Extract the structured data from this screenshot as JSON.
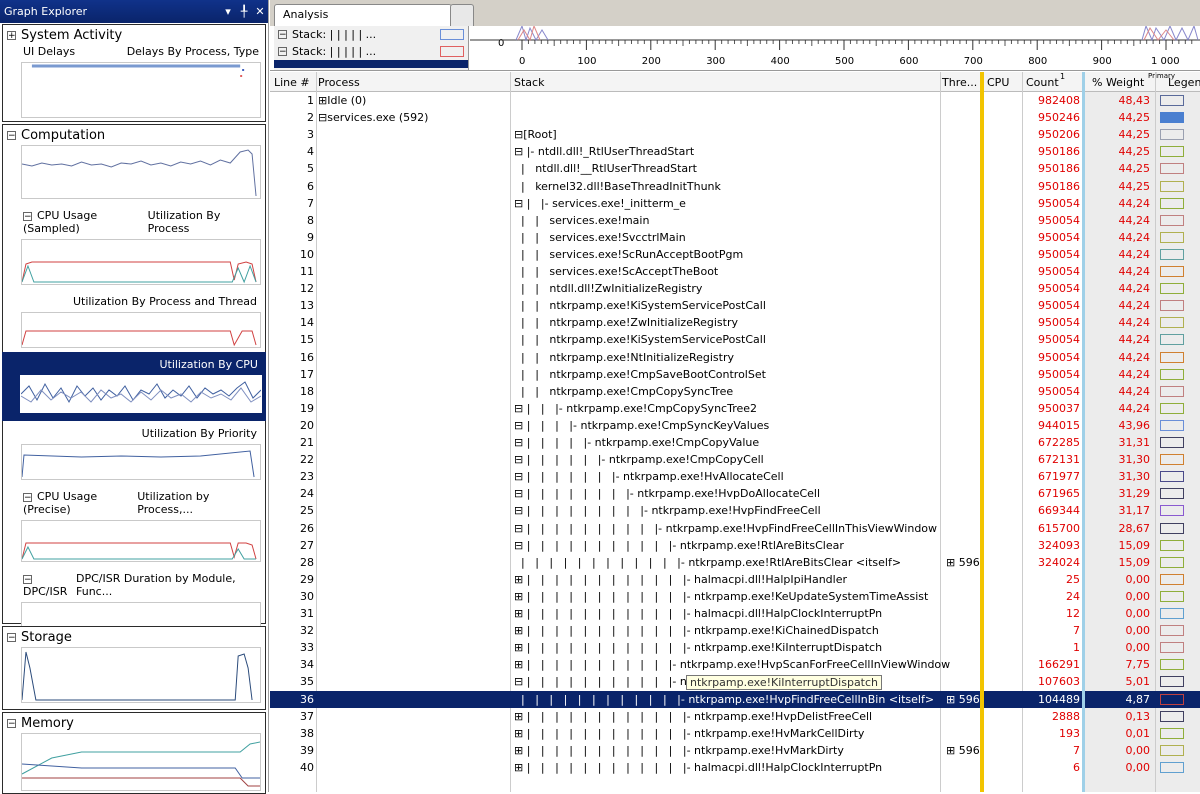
{
  "explorer": {
    "title": "Graph Explorer",
    "controls": [
      "▾",
      "╀",
      "✕"
    ],
    "groups": [
      {
        "name": "System Activity",
        "sub_left": "UI Delays",
        "sub_right": "Delays By Process, Type"
      },
      {
        "name": "Computation"
      },
      {
        "name": "CPU Usage (Sampled)",
        "sub_right": "Utilization By Process"
      },
      {
        "name": "Utilization By Process and Thread"
      },
      {
        "name": "Utilization By CPU"
      },
      {
        "name": "Utilization By Priority"
      },
      {
        "name": "CPU Usage (Precise)",
        "sub_right": "Utilization by Process,..."
      },
      {
        "name": "DPC/ISR",
        "sub_right": "DPC/ISR Duration by Module, Func..."
      },
      {
        "name": "Storage"
      },
      {
        "name": "Memory"
      }
    ]
  },
  "analysis": {
    "tab": "Analysis",
    "legend_rows": [
      {
        "label": "Stack:",
        "dots": "| | | | | ...",
        "color": "#6a8fd8"
      },
      {
        "label": "Stack:",
        "dots": "| | | | | ...",
        "color": "#e06060"
      },
      {
        "label": "Stack:",
        "dots": "| | | | | ...",
        "color": "#cc4444"
      }
    ],
    "axis_zero": "0",
    "axis_ticks": [
      "0",
      "100",
      "200",
      "300",
      "400",
      "500",
      "600",
      "700",
      "800",
      "900",
      "1 000"
    ]
  },
  "table": {
    "headers": {
      "line": "Line #",
      "process": "Process",
      "stack": "Stack",
      "thread": "Thre...",
      "cpu": "CPU",
      "count": "Count",
      "count_sup": "1",
      "weight": "% Weight",
      "weight_sup": "Primary",
      "legend": "Legend"
    },
    "tooltip": "ntkrpamp.exe!KiInterruptDispatch",
    "rows": [
      {
        "n": "1",
        "proc": "⊞Idle (0)",
        "stk": "",
        "thr": "",
        "cnt": "982408",
        "wt": "48,43",
        "lg": "#5a6a9a"
      },
      {
        "n": "2",
        "proc": "⊟services.exe (592)",
        "stk": "",
        "thr": "",
        "cnt": "950246",
        "wt": "44,25",
        "lg": "#4a7fd0",
        "lgfill": true
      },
      {
        "n": "3",
        "proc": "",
        "stk": "⊟[Root]",
        "thr": "",
        "cnt": "950206",
        "wt": "44,25",
        "lg": "#9aa0b0"
      },
      {
        "n": "4",
        "proc": "",
        "stk": "⊟ |- ntdll.dll!_RtlUserThreadStart",
        "thr": "",
        "cnt": "950186",
        "wt": "44,25",
        "lg": "#8fae3a"
      },
      {
        "n": "5",
        "proc": "",
        "stk": "  |   ntdll.dll!__RtlUserThreadStart",
        "thr": "",
        "cnt": "950186",
        "wt": "44,25",
        "lg": "#c08080"
      },
      {
        "n": "6",
        "proc": "",
        "stk": "  |   kernel32.dll!BaseThreadInitThunk",
        "thr": "",
        "cnt": "950186",
        "wt": "44,25",
        "lg": "#b0b050"
      },
      {
        "n": "7",
        "proc": "",
        "stk": "⊟ |   |- services.exe!_initterm_e",
        "thr": "",
        "cnt": "950054",
        "wt": "44,24",
        "lg": "#8fae3a"
      },
      {
        "n": "8",
        "proc": "",
        "stk": "  |   |   services.exe!main",
        "thr": "",
        "cnt": "950054",
        "wt": "44,24",
        "lg": "#c08080"
      },
      {
        "n": "9",
        "proc": "",
        "stk": "  |   |   services.exe!SvcctrlMain",
        "thr": "",
        "cnt": "950054",
        "wt": "44,24",
        "lg": "#b0b050"
      },
      {
        "n": "10",
        "proc": "",
        "stk": "  |   |   services.exe!ScRunAcceptBootPgm",
        "thr": "",
        "cnt": "950054",
        "wt": "44,24",
        "lg": "#60a0a0"
      },
      {
        "n": "11",
        "proc": "",
        "stk": "  |   |   services.exe!ScAcceptTheBoot",
        "thr": "",
        "cnt": "950054",
        "wt": "44,24",
        "lg": "#d08030"
      },
      {
        "n": "12",
        "proc": "",
        "stk": "  |   |   ntdll.dll!ZwInitializeRegistry",
        "thr": "",
        "cnt": "950054",
        "wt": "44,24",
        "lg": "#8fae3a"
      },
      {
        "n": "13",
        "proc": "",
        "stk": "  |   |   ntkrpamp.exe!KiSystemServicePostCall",
        "thr": "",
        "cnt": "950054",
        "wt": "44,24",
        "lg": "#c08080"
      },
      {
        "n": "14",
        "proc": "",
        "stk": "  |   |   ntkrpamp.exe!ZwInitializeRegistry",
        "thr": "",
        "cnt": "950054",
        "wt": "44,24",
        "lg": "#b0b050"
      },
      {
        "n": "15",
        "proc": "",
        "stk": "  |   |   ntkrpamp.exe!KiSystemServicePostCall",
        "thr": "",
        "cnt": "950054",
        "wt": "44,24",
        "lg": "#60a0a0"
      },
      {
        "n": "16",
        "proc": "",
        "stk": "  |   |   ntkrpamp.exe!NtInitializeRegistry",
        "thr": "",
        "cnt": "950054",
        "wt": "44,24",
        "lg": "#d08030"
      },
      {
        "n": "17",
        "proc": "",
        "stk": "  |   |   ntkrpamp.exe!CmpSaveBootControlSet",
        "thr": "",
        "cnt": "950054",
        "wt": "44,24",
        "lg": "#8fae3a"
      },
      {
        "n": "18",
        "proc": "",
        "stk": "  |   |   ntkrpamp.exe!CmpCopySyncTree",
        "thr": "",
        "cnt": "950054",
        "wt": "44,24",
        "lg": "#c08080"
      },
      {
        "n": "19",
        "proc": "",
        "stk": "⊟ |   |   |- ntkrpamp.exe!CmpCopySyncTree2",
        "thr": "",
        "cnt": "950037",
        "wt": "44,24",
        "lg": "#8fae3a"
      },
      {
        "n": "20",
        "proc": "",
        "stk": "⊟ |   |   |   |- ntkrpamp.exe!CmpSyncKeyValues",
        "thr": "",
        "cnt": "944015",
        "wt": "43,96",
        "lg": "#6a8fd8"
      },
      {
        "n": "21",
        "proc": "",
        "stk": "⊟ |   |   |   |   |- ntkrpamp.exe!CmpCopyValue",
        "thr": "",
        "cnt": "672285",
        "wt": "31,31",
        "lg": "#404060"
      },
      {
        "n": "22",
        "proc": "",
        "stk": "⊟ |   |   |   |   |   |- ntkrpamp.exe!CmpCopyCell",
        "thr": "",
        "cnt": "672131",
        "wt": "31,30",
        "lg": "#d08030"
      },
      {
        "n": "23",
        "proc": "",
        "stk": "⊟ |   |   |   |   |   |   |- ntkrpamp.exe!HvAllocateCell",
        "thr": "",
        "cnt": "671977",
        "wt": "31,30",
        "lg": "#4a4a8a"
      },
      {
        "n": "24",
        "proc": "",
        "stk": "⊟ |   |   |   |   |   |   |   |- ntkrpamp.exe!HvpDoAllocateCell",
        "thr": "",
        "cnt": "671965",
        "wt": "31,29",
        "lg": "#404060"
      },
      {
        "n": "25",
        "proc": "",
        "stk": "⊟ |   |   |   |   |   |   |   |   |- ntkrpamp.exe!HvpFindFreeCell",
        "thr": "",
        "cnt": "669344",
        "wt": "31,17",
        "lg": "#8a5ad0"
      },
      {
        "n": "26",
        "proc": "",
        "stk": "⊟ |   |   |   |   |   |   |   |   |   |- ntkrpamp.exe!HvpFindFreeCellInThisViewWindow",
        "thr": "",
        "cnt": "615700",
        "wt": "28,67",
        "lg": "#404060"
      },
      {
        "n": "27",
        "proc": "",
        "stk": "⊟ |   |   |   |   |   |   |   |   |   |   |- ntkrpamp.exe!RtlAreBitsClear",
        "thr": "",
        "cnt": "324093",
        "wt": "15,09",
        "lg": "#8fae3a"
      },
      {
        "n": "28",
        "proc": "",
        "stk": "  |   |   |   |   |   |   |   |   |   |   |   |- ntkrpamp.exe!RtlAreBitsClear <itself>",
        "thr": "⊞ 596",
        "cnt": "324024",
        "wt": "15,09",
        "lg": "#8fae3a"
      },
      {
        "n": "29",
        "proc": "",
        "stk": "⊞ |   |   |   |   |   |   |   |   |   |   |   |- halmacpi.dll!HalpIpiHandler",
        "thr": "",
        "cnt": "25",
        "wt": "0,00",
        "lg": "#d08030"
      },
      {
        "n": "30",
        "proc": "",
        "stk": "⊞ |   |   |   |   |   |   |   |   |   |   |   |- ntkrpamp.exe!KeUpdateSystemTimeAssist",
        "thr": "",
        "cnt": "24",
        "wt": "0,00",
        "lg": "#8fae3a"
      },
      {
        "n": "31",
        "proc": "",
        "stk": "⊞ |   |   |   |   |   |   |   |   |   |   |   |- halmacpi.dll!HalpClockInterruptPn",
        "thr": "",
        "cnt": "12",
        "wt": "0,00",
        "lg": "#60a0d0"
      },
      {
        "n": "32",
        "proc": "",
        "stk": "⊞ |   |   |   |   |   |   |   |   |   |   |   |- ntkrpamp.exe!KiChainedDispatch",
        "thr": "",
        "cnt": "7",
        "wt": "0,00",
        "lg": "#c08080"
      },
      {
        "n": "33",
        "proc": "",
        "stk": "⊞ |   |   |   |   |   |   |   |   |   |   |   |- ntkrpamp.exe!KiInterruptDispatch",
        "thr": "",
        "cnt": "1",
        "wt": "0,00",
        "lg": "#c08080"
      },
      {
        "n": "34",
        "proc": "",
        "stk": "⊞ |   |   |   |   |   |   |   |   |   |   |- ntkrpamp.exe!HvpScanForFreeCellInViewWindow",
        "thr": "",
        "cnt": "166291",
        "wt": "7,75",
        "lg": "#8fae3a"
      },
      {
        "n": "35",
        "proc": "",
        "stk": "⊟ |   |   |   |   |   |   |   |   |   |   |- ntkrpamp.exe!HvpFindFreeCellInBin",
        "thr": "",
        "cnt": "107603",
        "wt": "5,01",
        "lg": "#404060"
      },
      {
        "n": "36",
        "proc": "",
        "stk": "  |   |   |   |   |   |   |   |   |   |   |   |- ntkrpamp.exe!HvpFindFreeCellInBin <itself>",
        "thr": "⊞ 596",
        "cnt": "104489",
        "wt": "4,87",
        "lg": "#c04040",
        "selected": true
      },
      {
        "n": "37",
        "proc": "",
        "stk": "⊞ |   |   |   |   |   |   |   |   |   |   |   |- ntkrpamp.exe!HvpDelistFreeCell",
        "thr": "",
        "cnt": "2888",
        "wt": "0,13",
        "lg": "#404060"
      },
      {
        "n": "38",
        "proc": "",
        "stk": "⊞ |   |   |   |   |   |   |   |   |   |   |   |- ntkrpamp.exe!HvMarkCellDirty",
        "thr": "",
        "cnt": "193",
        "wt": "0,01",
        "lg": "#8fae3a"
      },
      {
        "n": "39",
        "proc": "",
        "stk": "⊞ |   |   |   |   |   |   |   |   |   |   |   |- ntkrpamp.exe!HvMarkDirty",
        "thr": "⊞ 596",
        "cnt": "7",
        "wt": "0,00",
        "lg": "#b0b050"
      },
      {
        "n": "40",
        "proc": "",
        "stk": "⊞ |   |   |   |   |   |   |   |   |   |   |   |- halmacpi.dll!HalpClockInterruptPn",
        "thr": "",
        "cnt": "6",
        "wt": "0,00",
        "lg": "#60a0d0"
      }
    ]
  }
}
